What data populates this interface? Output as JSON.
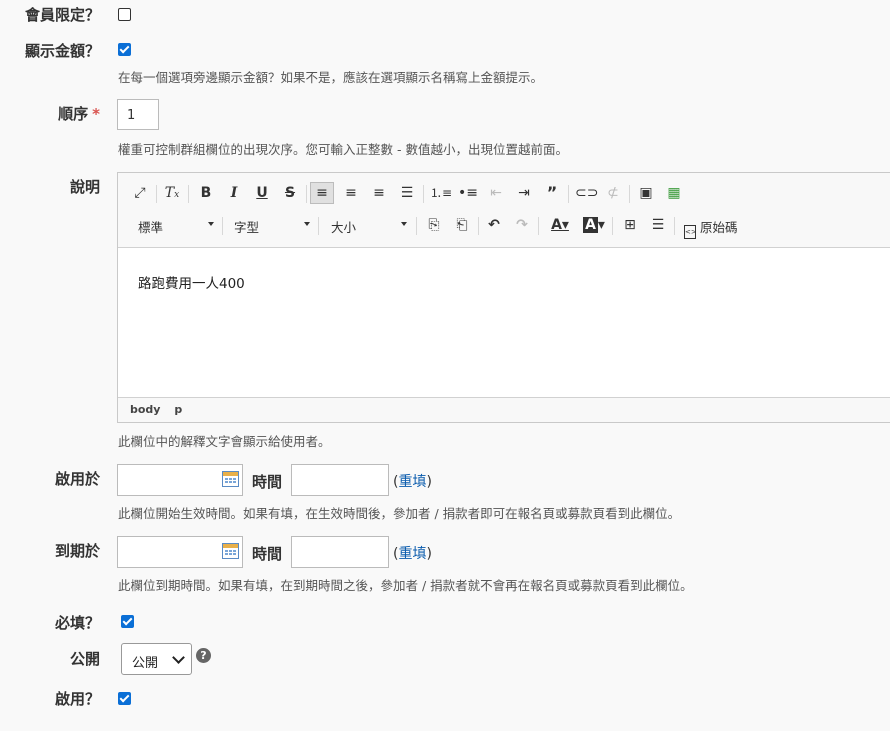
{
  "fields": {
    "members_only": {
      "label": "會員限定？",
      "checked": false
    },
    "show_amount": {
      "label": "顯示金額？",
      "checked": true,
      "help": "在每一個選項旁邊顯示金額？如果不是，應該在選項顯示名稱寫上金額提示。"
    },
    "order": {
      "label": "順序",
      "required_mark": "*",
      "value": "1",
      "help": "權重可控制群組欄位的出現次序。您可輸入正整數 - 數值越小，出現位置越前面。"
    },
    "description": {
      "label": "說明",
      "help": "此欄位中的解釋文字會顯示給使用者。",
      "editor": {
        "format_combo": "標準",
        "font_combo": "字型",
        "size_combo": "大小",
        "source_label": "原始碼",
        "content": "路跑費用一人400",
        "path": [
          "body",
          "p"
        ]
      }
    },
    "start": {
      "label": "啟用於",
      "time_label": "時間",
      "date_value": "",
      "time_value": "",
      "reset_open": "(",
      "reset_label": "重填",
      "reset_close": ")",
      "help": "此欄位開始生效時間。如果有填，在生效時間後，參加者 / 捐款者即可在報名頁或募款頁看到此欄位。"
    },
    "end": {
      "label": "到期於",
      "time_label": "時間",
      "date_value": "",
      "time_value": "",
      "reset_open": "(",
      "reset_label": "重填",
      "reset_close": ")",
      "help": "此欄位到期時間。如果有填，在到期時間之後，參加者 / 捐款者就不會再在報名頁或募款頁看到此欄位。"
    },
    "required": {
      "label": "必填？",
      "checked": true
    },
    "visibility": {
      "label": "公開",
      "selected": "公開",
      "help_icon": "?"
    },
    "enabled": {
      "label": "啟用？",
      "checked": true
    }
  },
  "colors": {
    "checkbox_on": "#0b6fd6",
    "required_star": "#d9534f",
    "link": "#0b5cad"
  }
}
